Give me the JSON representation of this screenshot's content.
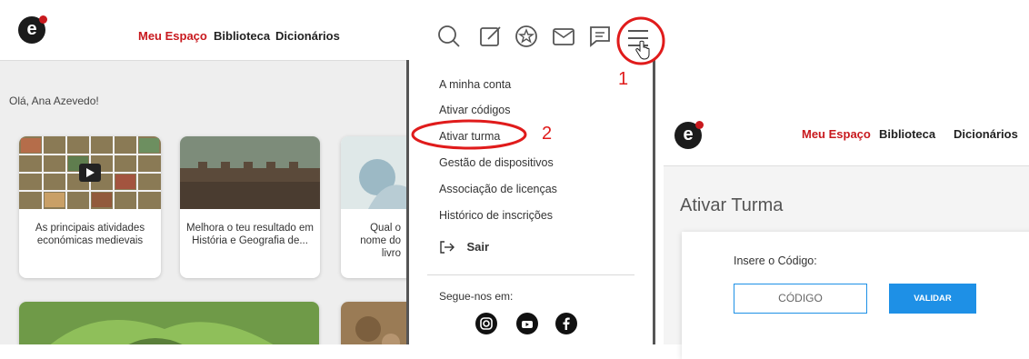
{
  "left": {
    "nav": {
      "meu_espaco": "Meu Espaço",
      "biblioteca": "Biblioteca",
      "dicionarios": "Dicionários"
    },
    "greeting": "Olá, Ana Azevedo!",
    "cards": [
      {
        "title": "As principais atividades económicas medievais"
      },
      {
        "title": "Melhora o teu resultado em História e Geografia de..."
      },
      {
        "title": "Qual o nome do livro"
      }
    ],
    "icons": [
      "search-icon",
      "edit-icon",
      "badge-icon",
      "mail-icon",
      "chat-icon",
      "menu-icon"
    ]
  },
  "menu": {
    "items": [
      "A minha conta",
      "Ativar códigos",
      "Ativar turma",
      "Gestão de dispositivos",
      "Associação de licenças",
      "Histórico de inscrições"
    ],
    "logout": "Sair",
    "follow": "Segue-nos em:",
    "social": [
      "instagram-icon",
      "youtube-icon",
      "facebook-icon"
    ]
  },
  "annotations": {
    "step1": "1",
    "step2": "2"
  },
  "right": {
    "nav": {
      "meu_espaco": "Meu Espaço",
      "biblioteca": "Biblioteca",
      "dicionarios": "Dicionários"
    },
    "page_title": "Ativar Turma",
    "code_label": "Insere o Código:",
    "code_placeholder": "CÓDIGO",
    "validate": "VALIDAR"
  },
  "colors": {
    "brand_red": "#c8191e",
    "annotation_red": "#e01b1b",
    "button_blue": "#1e90e6"
  }
}
